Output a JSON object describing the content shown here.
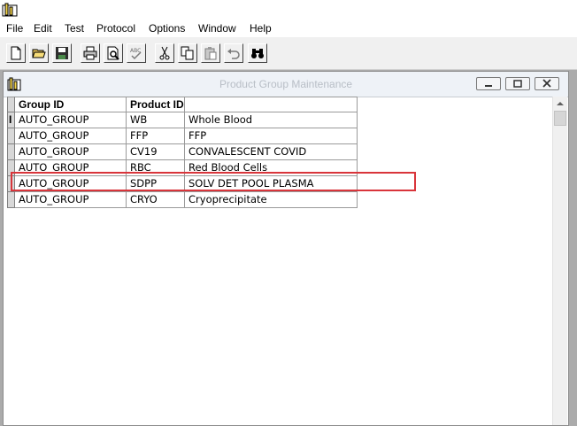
{
  "menu": {
    "items": [
      "File",
      "Edit",
      "Test",
      "Protocol",
      "Options",
      "Window",
      "Help"
    ]
  },
  "toolbar": {
    "buttons": [
      "new-document",
      "open-folder",
      "save",
      "print",
      "print-preview",
      "spell-check",
      "cut",
      "copy",
      "paste",
      "undo",
      "find"
    ]
  },
  "window": {
    "title": "Product Group Maintenance"
  },
  "grid": {
    "columns": [
      "Group ID",
      "Product ID",
      ""
    ],
    "rows": [
      [
        "AUTO_GROUP",
        "WB",
        "Whole Blood"
      ],
      [
        "AUTO_GROUP",
        "FFP",
        "FFP"
      ],
      [
        "AUTO_GROUP",
        "CV19",
        "CONVALESCENT COVID"
      ],
      [
        "AUTO_GROUP",
        "RBC",
        "Red Blood Cells"
      ],
      [
        "AUTO_GROUP",
        "SDPP",
        "SOLV DET POOL PLASMA"
      ],
      [
        "AUTO_GROUP",
        "CRYO",
        "Cryoprecipitate"
      ]
    ],
    "highlighted_row": 4
  },
  "colors": {
    "highlight": "#d9353b"
  }
}
